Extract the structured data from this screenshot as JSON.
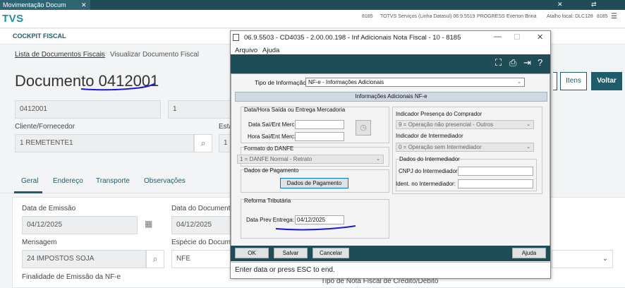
{
  "top_tab": {
    "title": "Movimentação Docum",
    "close": "✕"
  },
  "header": {
    "logo": "TVS",
    "items": [
      "8185",
      "TOTVS Serviços (Linha Datasul) 06.9.5519",
      "PROGRESS",
      "Everton Brina",
      "Atalho local: DLC128",
      "8185"
    ],
    "icons": [
      "✕",
      "⇄",
      "☰"
    ]
  },
  "subheader": {
    "title": "COCKPIT FISCAL"
  },
  "breadcrumb": {
    "link": "Lista de Documentos Fiscais",
    "separator": "›",
    "current": "Visualizar Documento Fiscal"
  },
  "document": {
    "title_prefix": "Documento",
    "number": "0412001",
    "field1_value": "0412001",
    "field2_value": "1",
    "client_label": "Cliente/Fornecedor",
    "client_value": "1  REMETENTE1",
    "esta_label": "Esta",
    "esta_value": "1"
  },
  "page_buttons": {
    "itens": "Itens",
    "voltar": "Voltar"
  },
  "tabs": [
    "Geral",
    "Endereço",
    "Transporte",
    "Observações"
  ],
  "form": {
    "emissao_label": "Data de Emissão",
    "emissao_value": "04/12/2025",
    "documento_label": "Data do Documento",
    "documento_value": "04/12/2025",
    "mensagem_label": "Mensagem",
    "mensagem_value": "24  IMPOSTOS SOJA",
    "especie_label": "Espécie do Documen",
    "especie_value": "NFE",
    "finalidade_label": "Finalidade de Emissão da NF-e",
    "tipo_nota_label": "Tipo de Nota Fiscal de Crédito/Débito"
  },
  "dialog": {
    "title": "06.9.5503 - CD4035 - 2.00.00.198 - Inf Adicionais Nota Fiscal - 10 - 8185",
    "menu": [
      "Arquivo",
      "Ajuda"
    ],
    "tipo_info_label": "Tipo de Informação:",
    "tipo_info_value": "NF-e - Informações Adicionais",
    "section_title": "Informações Adicionais NF-e",
    "saida_group": "Data/Hora Saída ou Entrega Mercadoria",
    "data_label": "Data Saí/Ent Merc:",
    "hora_label": "Hora Saí/Ent Merc:",
    "formato_group": "Formato do DANFE",
    "formato_value": "1 = DANFE Normal - Retrato",
    "pagamento_group": "Dados de Pagamento",
    "pagamento_button": "Dados de Pagamento",
    "reforma_group": "Reforma Tributária",
    "prev_entrega_label": "Data Prev Entrega:",
    "prev_entrega_value": "04/12/2025",
    "presenca_label": "Indicador Presença do Comprador",
    "presenca_value": "9 = Operação não presencial - Outros",
    "intermediador_label": "Indicador de Intermediador",
    "intermediador_value": "0 = Operação sem Intermediador",
    "dados_inter_group": "Dados do Intermediador",
    "cnpj_label": "CNPJ do Intermediador:",
    "ident_label": "Ident. no Intermediador:",
    "btn_ok": "OK",
    "btn_salvar": "Salvar",
    "btn_cancelar": "Cancelar",
    "btn_ajuda": "Ajuda",
    "status": "Enter data or press ESC to end."
  },
  "colors": {
    "brand_dark": "#1f4d57",
    "accent": "#1d5d6c",
    "ink_annotation": "#1a1ad6"
  }
}
